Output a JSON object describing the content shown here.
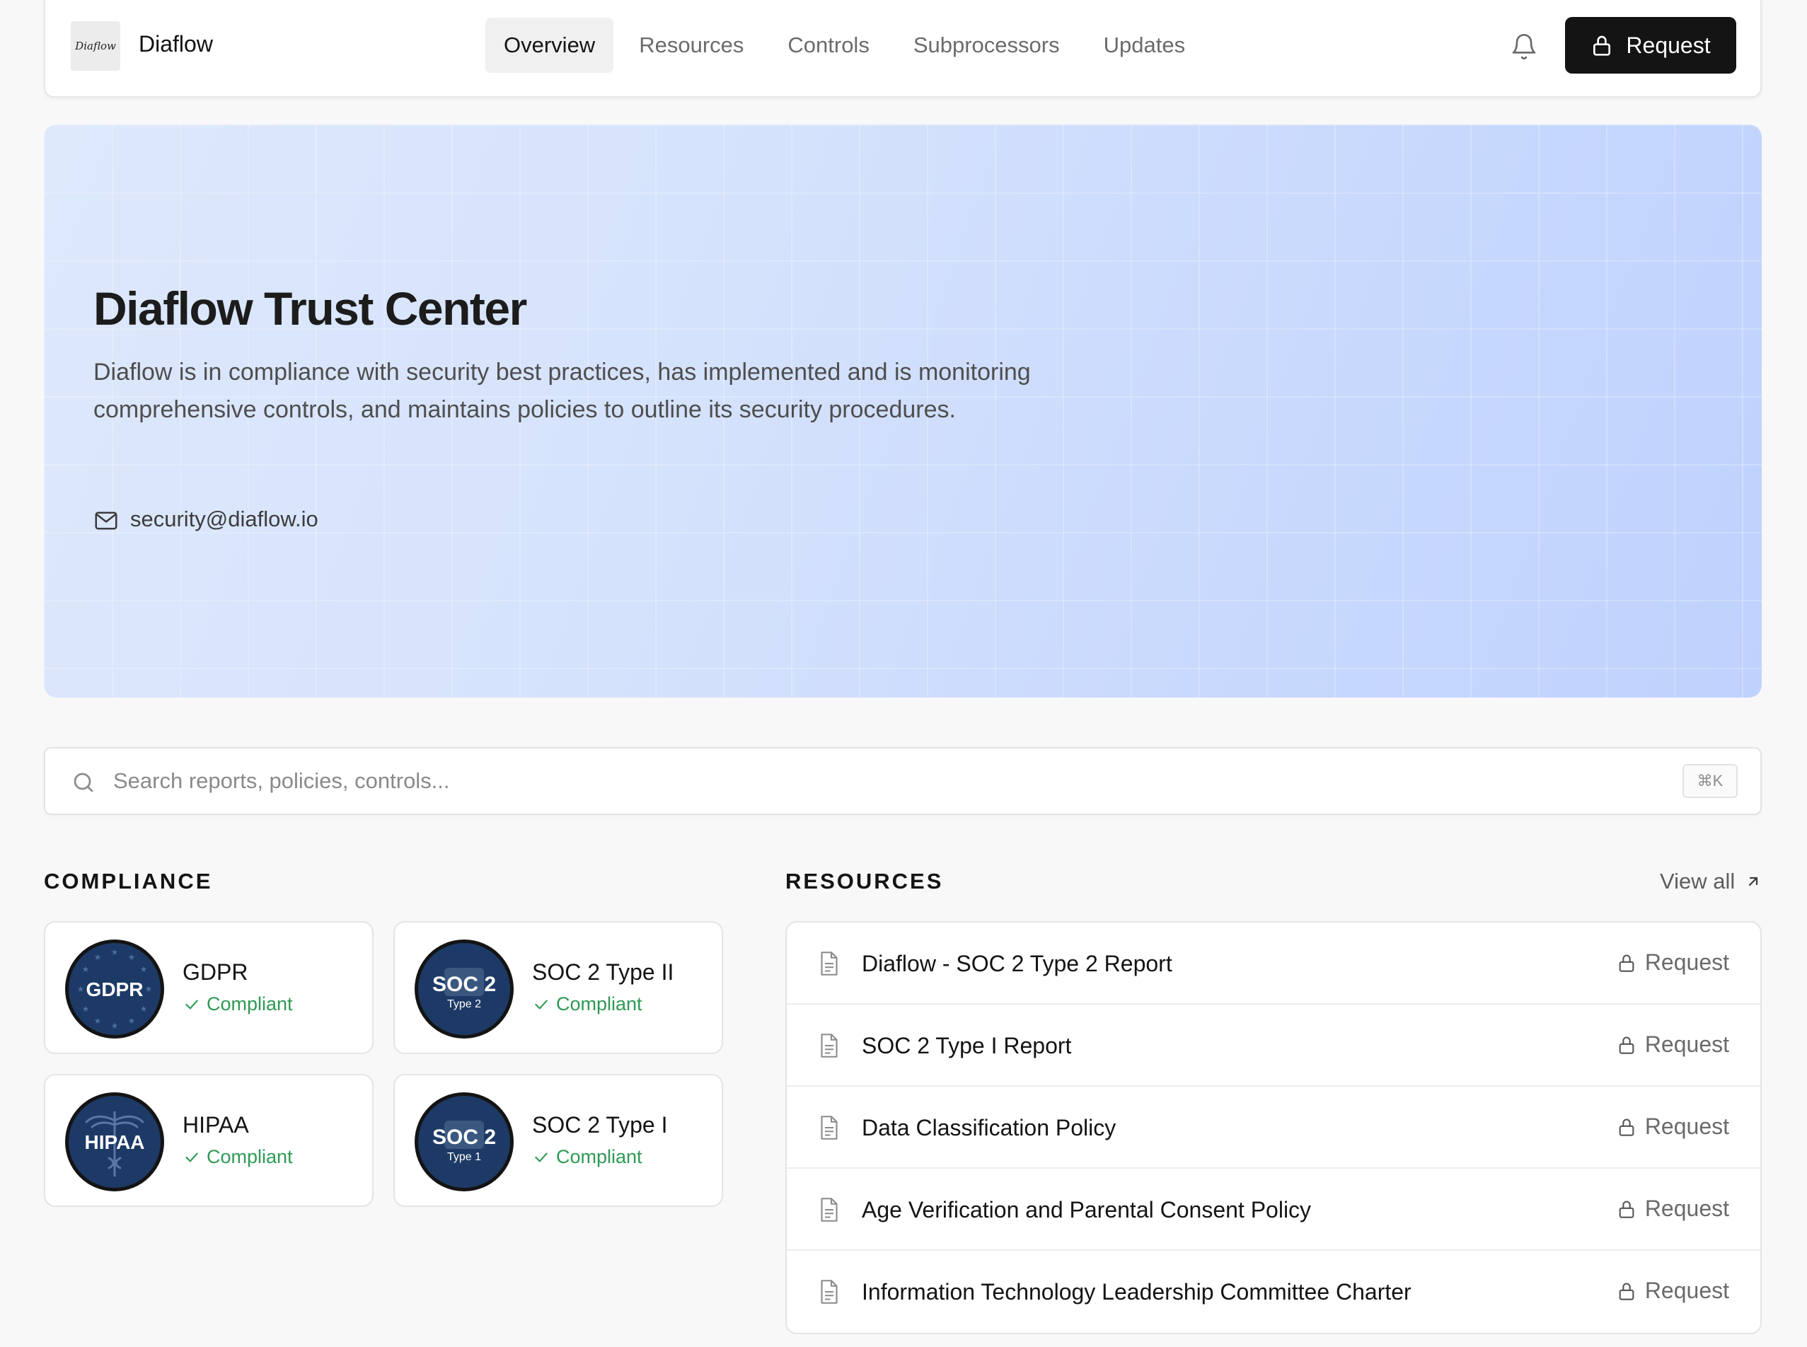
{
  "brand": {
    "logo_text": "Diaflow",
    "name": "Diaflow"
  },
  "nav": {
    "items": [
      {
        "label": "Overview",
        "active": true
      },
      {
        "label": "Resources"
      },
      {
        "label": "Controls"
      },
      {
        "label": "Subprocessors"
      },
      {
        "label": "Updates"
      }
    ]
  },
  "header": {
    "request_label": "Request"
  },
  "hero": {
    "title": "Diaflow Trust Center",
    "description": "Diaflow is in compliance with security best practices, has implemented and is monitoring comprehensive controls, and maintains policies to outline its security procedures.",
    "email": "security@diaflow.io"
  },
  "search": {
    "placeholder": "Search reports, policies, controls...",
    "shortcut": "⌘K"
  },
  "compliance": {
    "title": "COMPLIANCE",
    "items": [
      {
        "name": "GDPR",
        "status": "Compliant",
        "badge_main": "GDPR",
        "badge_sub": ""
      },
      {
        "name": "SOC 2 Type II",
        "status": "Compliant",
        "badge_main": "SOC 2",
        "badge_sub": "Type 2"
      },
      {
        "name": "HIPAA",
        "status": "Compliant",
        "badge_main": "HIPAA",
        "badge_sub": ""
      },
      {
        "name": "SOC 2 Type I",
        "status": "Compliant",
        "badge_main": "SOC 2",
        "badge_sub": "Type 1"
      }
    ]
  },
  "resources": {
    "title": "RESOURCES",
    "view_all": "View all",
    "items": [
      {
        "title": "Diaflow - SOC 2 Type 2 Report",
        "action": "Request"
      },
      {
        "title": "SOC 2 Type I Report",
        "action": "Request"
      },
      {
        "title": "Data Classification Policy",
        "action": "Request"
      },
      {
        "title": "Age Verification and Parental Consent Policy",
        "action": "Request"
      },
      {
        "title": "Information Technology Leadership Committee Charter",
        "action": "Request"
      }
    ]
  },
  "colors": {
    "accent_dark": "#141414",
    "compliant_green": "#2e9a54",
    "badge_navy": "#1d3a66",
    "hero_gradient_start": "#dde8fb",
    "hero_gradient_end": "#bfd2fd"
  }
}
